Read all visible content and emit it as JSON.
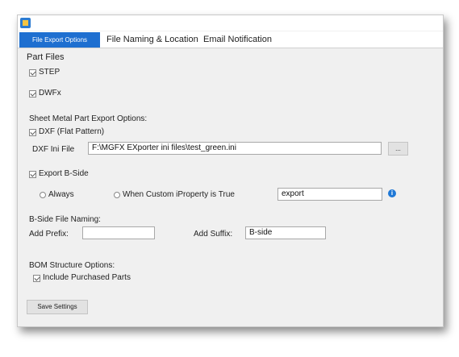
{
  "tabs": {
    "file_export": "File Export Options",
    "file_naming": "File Naming & Location",
    "email": "Email Notification"
  },
  "part_files": {
    "heading": "Part Files",
    "step": "STEP",
    "dwfx": "DWFx"
  },
  "sheet_metal": {
    "heading": "Sheet Metal Part Export Options:",
    "dxf": "DXF (Flat Pattern)",
    "dxf_ini_label": "DXF Ini File",
    "dxf_ini_value": "F:\\MGFX EXporter ini files\\test_green.ini",
    "browse": "..."
  },
  "bside": {
    "export": "Export B-Side",
    "always": "Always",
    "when_custom": "When Custom iProperty is True",
    "iproperty_value": "export",
    "info_icon": "i"
  },
  "naming": {
    "heading": "B-Side File Naming:",
    "prefix_label": "Add Prefix:",
    "prefix_value": "",
    "suffix_label": "Add Suffix:",
    "suffix_value": "B-side"
  },
  "bom": {
    "heading": "BOM Structure Options:",
    "include_purchased": "Include Purchased Parts"
  },
  "save_button": "Save Settings"
}
